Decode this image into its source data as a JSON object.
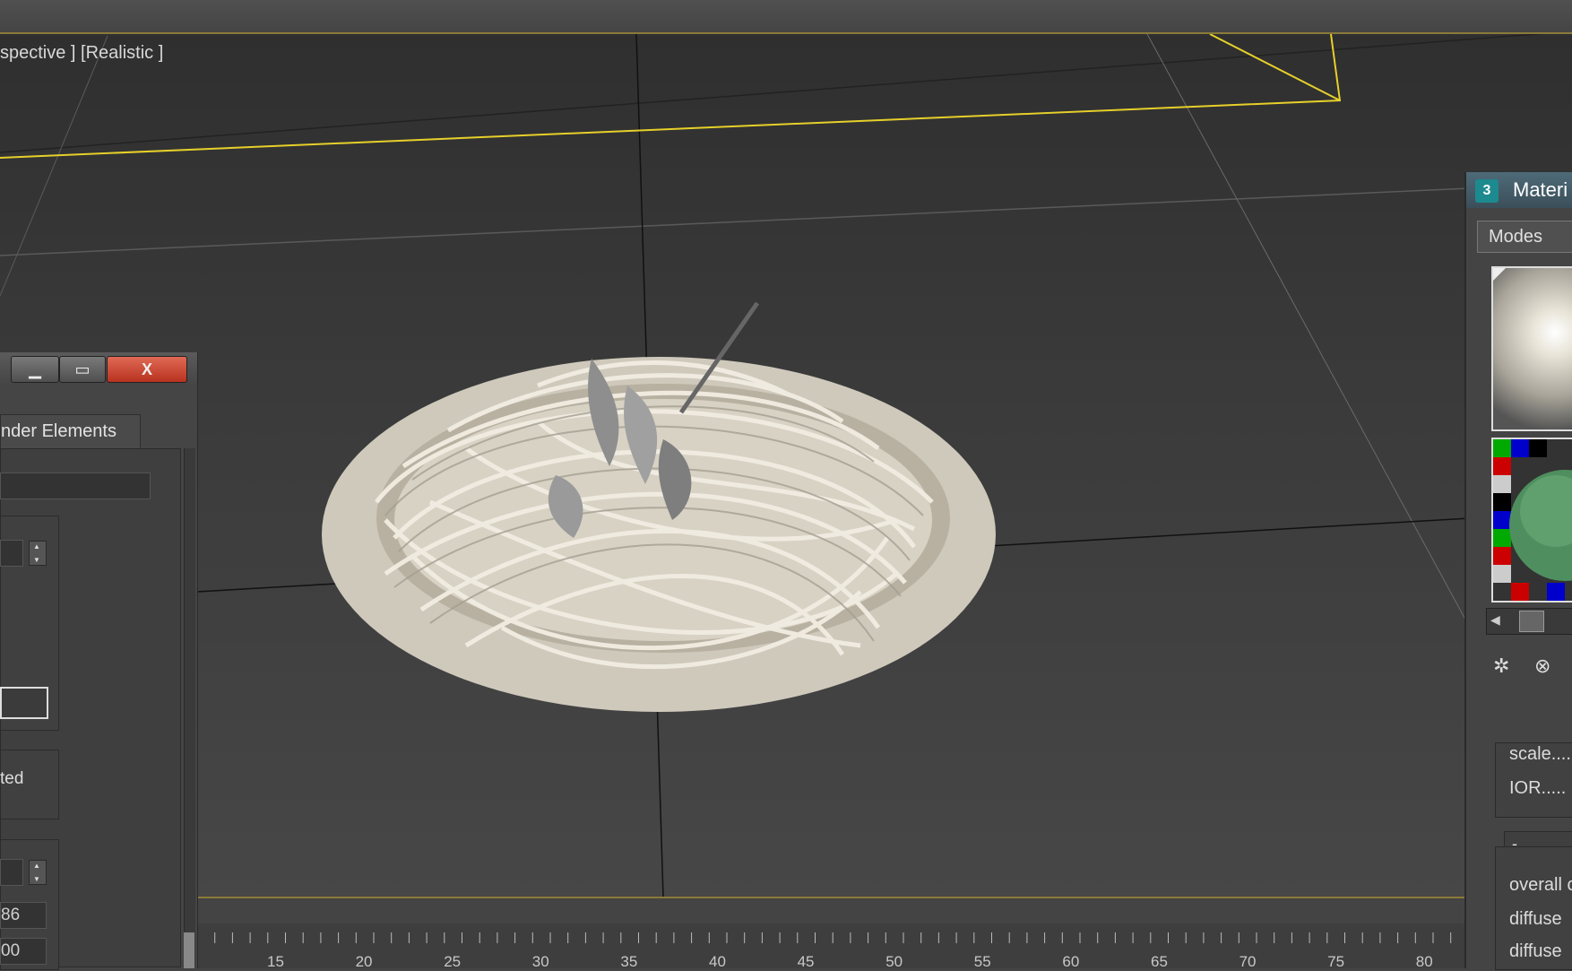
{
  "viewport": {
    "label": "spective ] [Realistic ]"
  },
  "dialog": {
    "tab_label": "nder Elements",
    "checkbox_label": "ted",
    "field_value_1": "86",
    "field_value_2": "00"
  },
  "material_editor": {
    "title": "Materi",
    "menu_modes": "Modes",
    "params": {
      "scale": "scale....",
      "ior": "IOR.....",
      "overall": "overall c",
      "diffuse1": "diffuse",
      "diffuse2": "diffuse"
    },
    "rollout_label": "-"
  },
  "ruler": {
    "ticks": [
      "15",
      "20",
      "25",
      "30",
      "35",
      "40",
      "45",
      "50",
      "55",
      "60",
      "65",
      "70",
      "75",
      "80"
    ]
  },
  "icons": {
    "minimize": "minimize-icon",
    "maximize": "maximize-icon",
    "close": "close-icon",
    "logo": "3ds-logo-icon"
  }
}
